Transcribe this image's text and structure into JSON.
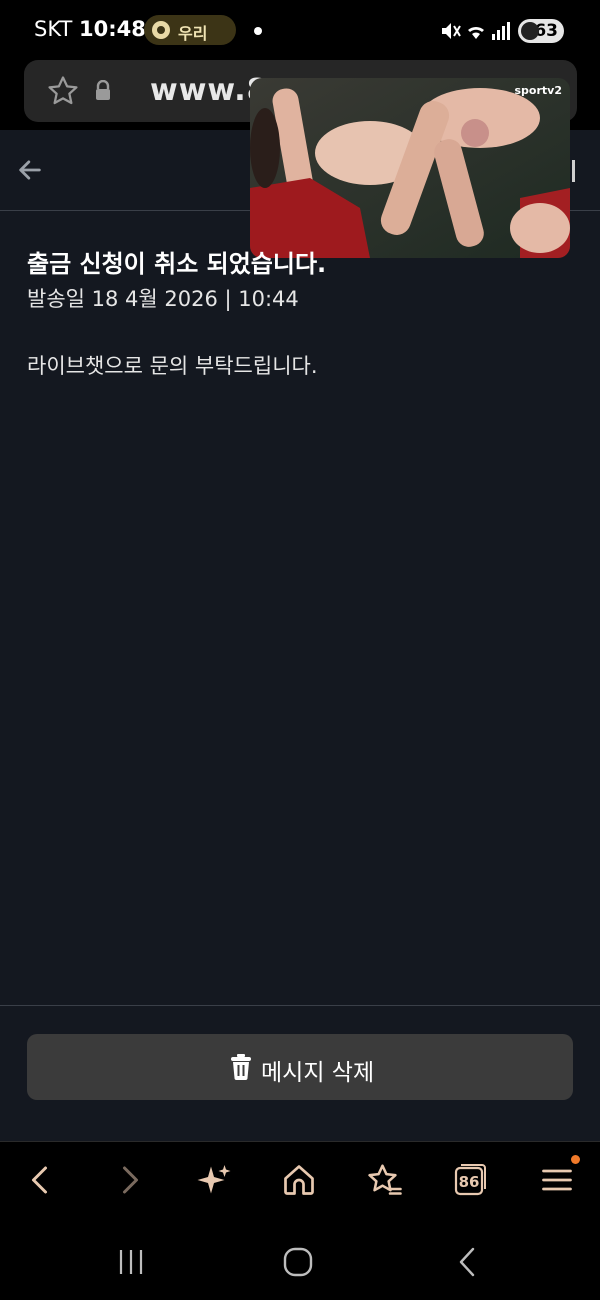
{
  "status_bar": {
    "carrier": "SKT",
    "time": "10:48",
    "pill_label": "우리",
    "battery": "63"
  },
  "url_bar": {
    "url_text": "www.8"
  },
  "video_overlay": {
    "logo": "sportv2"
  },
  "message": {
    "title": "출금 신청이 취소 되었습니다.",
    "sent_date": "발송일 18 4월 2026 | 10:44",
    "body": "라이브챗으로 문의 부탁드립니다."
  },
  "actions": {
    "delete_label": "메시지 삭제"
  },
  "toolbar": {
    "tabs_count": "86"
  },
  "colors": {
    "background": "#141820",
    "accent": "#e8c9b0",
    "notification": "#f07a2a"
  }
}
